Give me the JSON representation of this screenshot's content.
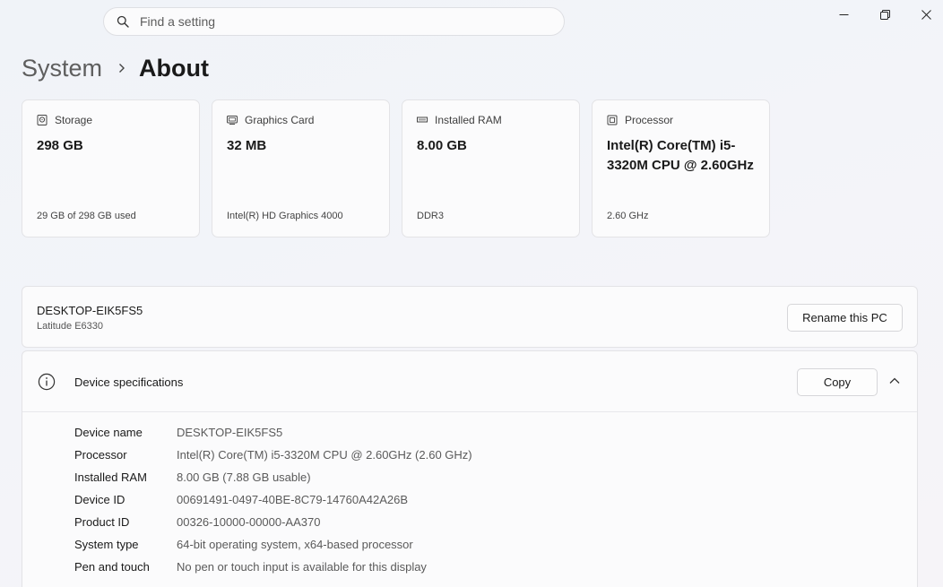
{
  "search": {
    "placeholder": "Find a setting"
  },
  "window_controls": {
    "minimize_icon": "minimize-icon",
    "restore_icon": "restore-icon",
    "close_icon": "close-icon"
  },
  "breadcrumb": {
    "parent": "System",
    "current": "About"
  },
  "cards": [
    {
      "icon": "storage-icon",
      "label": "Storage",
      "value": "298 GB",
      "sub": "29 GB of 298 GB used"
    },
    {
      "icon": "graphics-card-icon",
      "label": "Graphics Card",
      "value": "32 MB",
      "sub": "Intel(R) HD Graphics 4000"
    },
    {
      "icon": "ram-icon",
      "label": "Installed RAM",
      "value": "8.00 GB",
      "sub": "DDR3"
    },
    {
      "icon": "processor-icon",
      "label": "Processor",
      "value": "Intel(R) Core(TM) i5-3320M CPU @ 2.60GHz",
      "sub": "2.60 GHz"
    }
  ],
  "pc": {
    "name": "DESKTOP-EIK5FS5",
    "model": "Latitude E6330",
    "rename_label": "Rename this PC"
  },
  "specs": {
    "title": "Device specifications",
    "copy_label": "Copy",
    "rows": [
      {
        "key": "Device name",
        "value": "DESKTOP-EIK5FS5"
      },
      {
        "key": "Processor",
        "value": "Intel(R) Core(TM) i5-3320M CPU @ 2.60GHz (2.60 GHz)"
      },
      {
        "key": "Installed RAM",
        "value": "8.00 GB (7.88 GB usable)"
      },
      {
        "key": "Device ID",
        "value": "00691491-0497-40BE-8C79-14760A42A26B"
      },
      {
        "key": "Product ID",
        "value": "00326-10000-00000-AA370"
      },
      {
        "key": "System type",
        "value": "64-bit operating system, x64-based processor"
      },
      {
        "key": "Pen and touch",
        "value": "No pen or touch input is available for this display"
      }
    ]
  }
}
